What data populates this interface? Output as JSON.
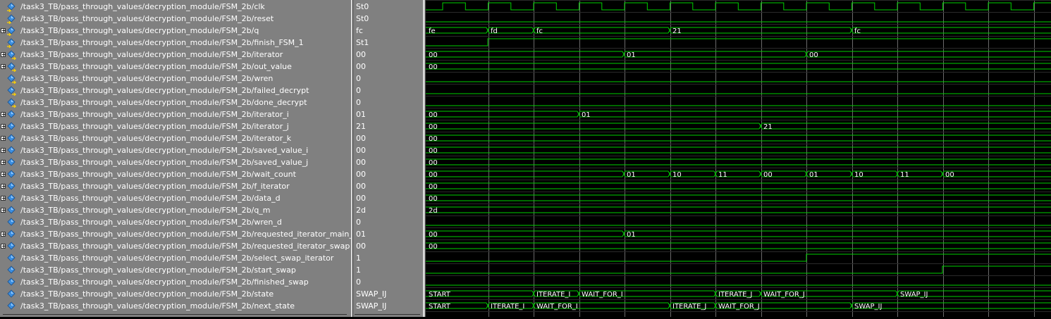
{
  "signals": [
    {
      "path": "/task3_TB/pass_through_values/decryption_module/FSM_2b/clk",
      "value": "St0",
      "expandable": false,
      "kind": "in"
    },
    {
      "path": "/task3_TB/pass_through_values/decryption_module/FSM_2b/reset",
      "value": "St0",
      "expandable": false,
      "kind": "in"
    },
    {
      "path": "/task3_TB/pass_through_values/decryption_module/FSM_2b/q",
      "value": "fc",
      "expandable": true,
      "kind": "in"
    },
    {
      "path": "/task3_TB/pass_through_values/decryption_module/FSM_2b/finish_FSM_1",
      "value": "St1",
      "expandable": false,
      "kind": "in"
    },
    {
      "path": "/task3_TB/pass_through_values/decryption_module/FSM_2b/iterator",
      "value": "00",
      "expandable": true,
      "kind": "out"
    },
    {
      "path": "/task3_TB/pass_through_values/decryption_module/FSM_2b/out_value",
      "value": "00",
      "expandable": true,
      "kind": "out"
    },
    {
      "path": "/task3_TB/pass_through_values/decryption_module/FSM_2b/wren",
      "value": "0",
      "expandable": false,
      "kind": "out"
    },
    {
      "path": "/task3_TB/pass_through_values/decryption_module/FSM_2b/failed_decrypt",
      "value": "0",
      "expandable": false,
      "kind": "out"
    },
    {
      "path": "/task3_TB/pass_through_values/decryption_module/FSM_2b/done_decrypt",
      "value": "0",
      "expandable": false,
      "kind": "out"
    },
    {
      "path": "/task3_TB/pass_through_values/decryption_module/FSM_2b/iterator_i",
      "value": "01",
      "expandable": true,
      "kind": "int"
    },
    {
      "path": "/task3_TB/pass_through_values/decryption_module/FSM_2b/iterator_j",
      "value": "21",
      "expandable": true,
      "kind": "int"
    },
    {
      "path": "/task3_TB/pass_through_values/decryption_module/FSM_2b/iterator_k",
      "value": "00",
      "expandable": true,
      "kind": "int"
    },
    {
      "path": "/task3_TB/pass_through_values/decryption_module/FSM_2b/saved_value_i",
      "value": "00",
      "expandable": true,
      "kind": "int"
    },
    {
      "path": "/task3_TB/pass_through_values/decryption_module/FSM_2b/saved_value_j",
      "value": "00",
      "expandable": true,
      "kind": "int"
    },
    {
      "path": "/task3_TB/pass_through_values/decryption_module/FSM_2b/wait_count",
      "value": "00",
      "expandable": true,
      "kind": "int"
    },
    {
      "path": "/task3_TB/pass_through_values/decryption_module/FSM_2b/f_iterator",
      "value": "00",
      "expandable": true,
      "kind": "int"
    },
    {
      "path": "/task3_TB/pass_through_values/decryption_module/FSM_2b/data_d",
      "value": "00",
      "expandable": true,
      "kind": "int"
    },
    {
      "path": "/task3_TB/pass_through_values/decryption_module/FSM_2b/q_m",
      "value": "2d",
      "expandable": true,
      "kind": "int"
    },
    {
      "path": "/task3_TB/pass_through_values/decryption_module/FSM_2b/wren_d",
      "value": "0",
      "expandable": false,
      "kind": "int"
    },
    {
      "path": "/task3_TB/pass_through_values/decryption_module/FSM_2b/requested_iterator_main_loop",
      "value": "01",
      "expandable": true,
      "kind": "int"
    },
    {
      "path": "/task3_TB/pass_through_values/decryption_module/FSM_2b/requested_iterator_swap",
      "value": "00",
      "expandable": true,
      "kind": "int"
    },
    {
      "path": "/task3_TB/pass_through_values/decryption_module/FSM_2b/select_swap_iterator",
      "value": "1",
      "expandable": false,
      "kind": "int"
    },
    {
      "path": "/task3_TB/pass_through_values/decryption_module/FSM_2b/start_swap",
      "value": "1",
      "expandable": false,
      "kind": "int"
    },
    {
      "path": "/task3_TB/pass_through_values/decryption_module/FSM_2b/finished_swap",
      "value": "0",
      "expandable": false,
      "kind": "int"
    },
    {
      "path": "/task3_TB/pass_through_values/decryption_module/FSM_2b/state",
      "value": "SWAP_IJ",
      "expandable": false,
      "kind": "int"
    },
    {
      "path": "/task3_TB/pass_through_values/decryption_module/FSM_2b/next_state",
      "value": "SWAP_IJ",
      "expandable": false,
      "kind": "int"
    }
  ],
  "waves": [
    {
      "type": "clock"
    },
    {
      "type": "bit",
      "segments": [
        {
          "t": 0,
          "v": 0
        }
      ]
    },
    {
      "type": "bus",
      "segments": [
        {
          "t": 0,
          "label": "fe"
        },
        {
          "t": 88,
          "label": "fd"
        },
        {
          "t": 153,
          "label": "fc"
        },
        {
          "t": 346,
          "label": "21"
        },
        {
          "t": 604,
          "label": "fc"
        }
      ]
    },
    {
      "type": "bit",
      "segments": [
        {
          "t": 0,
          "v": 0
        },
        {
          "t": 88,
          "v": 1
        }
      ]
    },
    {
      "type": "bus",
      "segments": [
        {
          "t": 0,
          "label": "00"
        },
        {
          "t": 281,
          "label": "01"
        },
        {
          "t": 540,
          "label": "00"
        }
      ]
    },
    {
      "type": "bus",
      "segments": [
        {
          "t": 0,
          "label": "00"
        }
      ]
    },
    {
      "type": "bit",
      "segments": [
        {
          "t": 0,
          "v": 0
        }
      ]
    },
    {
      "type": "bit",
      "segments": [
        {
          "t": 0,
          "v": 0
        }
      ]
    },
    {
      "type": "bit",
      "segments": [
        {
          "t": 0,
          "v": 0
        }
      ]
    },
    {
      "type": "bus",
      "segments": [
        {
          "t": 0,
          "label": "00"
        },
        {
          "t": 217,
          "label": "01"
        }
      ]
    },
    {
      "type": "bus",
      "segments": [
        {
          "t": 0,
          "label": "00"
        },
        {
          "t": 475,
          "label": "21"
        }
      ]
    },
    {
      "type": "bus",
      "segments": [
        {
          "t": 0,
          "label": "00"
        }
      ]
    },
    {
      "type": "bus",
      "segments": [
        {
          "t": 0,
          "label": "00"
        }
      ]
    },
    {
      "type": "bus",
      "segments": [
        {
          "t": 0,
          "label": "00"
        }
      ]
    },
    {
      "type": "bus",
      "segments": [
        {
          "t": 0,
          "label": "00"
        },
        {
          "t": 281,
          "label": "01"
        },
        {
          "t": 346,
          "label": "10"
        },
        {
          "t": 411,
          "label": "11"
        },
        {
          "t": 475,
          "label": "00"
        },
        {
          "t": 540,
          "label": "01"
        },
        {
          "t": 604,
          "label": "10"
        },
        {
          "t": 669,
          "label": "11"
        },
        {
          "t": 733,
          "label": "00"
        }
      ]
    },
    {
      "type": "bus",
      "segments": [
        {
          "t": 0,
          "label": "00"
        }
      ]
    },
    {
      "type": "bus",
      "segments": [
        {
          "t": 0,
          "label": "00"
        }
      ]
    },
    {
      "type": "bus",
      "segments": [
        {
          "t": 0,
          "label": "2d"
        }
      ]
    },
    {
      "type": "bit",
      "segments": [
        {
          "t": 0,
          "v": 0
        }
      ]
    },
    {
      "type": "bus",
      "segments": [
        {
          "t": 0,
          "label": "00"
        },
        {
          "t": 281,
          "label": "01"
        }
      ]
    },
    {
      "type": "bus",
      "segments": [
        {
          "t": 0,
          "label": "00"
        }
      ]
    },
    {
      "type": "bit",
      "segments": [
        {
          "t": 0,
          "v": 0
        },
        {
          "t": 540,
          "v": 1
        }
      ]
    },
    {
      "type": "bit",
      "segments": [
        {
          "t": 0,
          "v": 0
        },
        {
          "t": 733,
          "v": 1
        }
      ]
    },
    {
      "type": "bit",
      "segments": [
        {
          "t": 0,
          "v": 0
        }
      ]
    },
    {
      "type": "bus",
      "segments": [
        {
          "t": 0,
          "label": "START"
        },
        {
          "t": 153,
          "label": "ITERATE_I"
        },
        {
          "t": 217,
          "label": "WAIT_FOR_I"
        },
        {
          "t": 411,
          "label": "ITERATE_J"
        },
        {
          "t": 475,
          "label": "WAIT_FOR_J"
        },
        {
          "t": 669,
          "label": "SWAP_IJ"
        }
      ]
    },
    {
      "type": "bus",
      "segments": [
        {
          "t": 0,
          "label": "START"
        },
        {
          "t": 88,
          "label": "ITERATE_I"
        },
        {
          "t": 153,
          "label": "WAIT_FOR_I"
        },
        {
          "t": 346,
          "label": "ITERATE_J"
        },
        {
          "t": 411,
          "label": "WAIT_FOR_J"
        },
        {
          "t": 604,
          "label": "SWAP_IJ"
        }
      ]
    }
  ],
  "clock": {
    "first_edge": 24,
    "period": 64.5
  },
  "colors": {
    "wave": "#00d000",
    "grid": "#6a6a6a",
    "panel": "#808080",
    "text": "#ffffff"
  }
}
